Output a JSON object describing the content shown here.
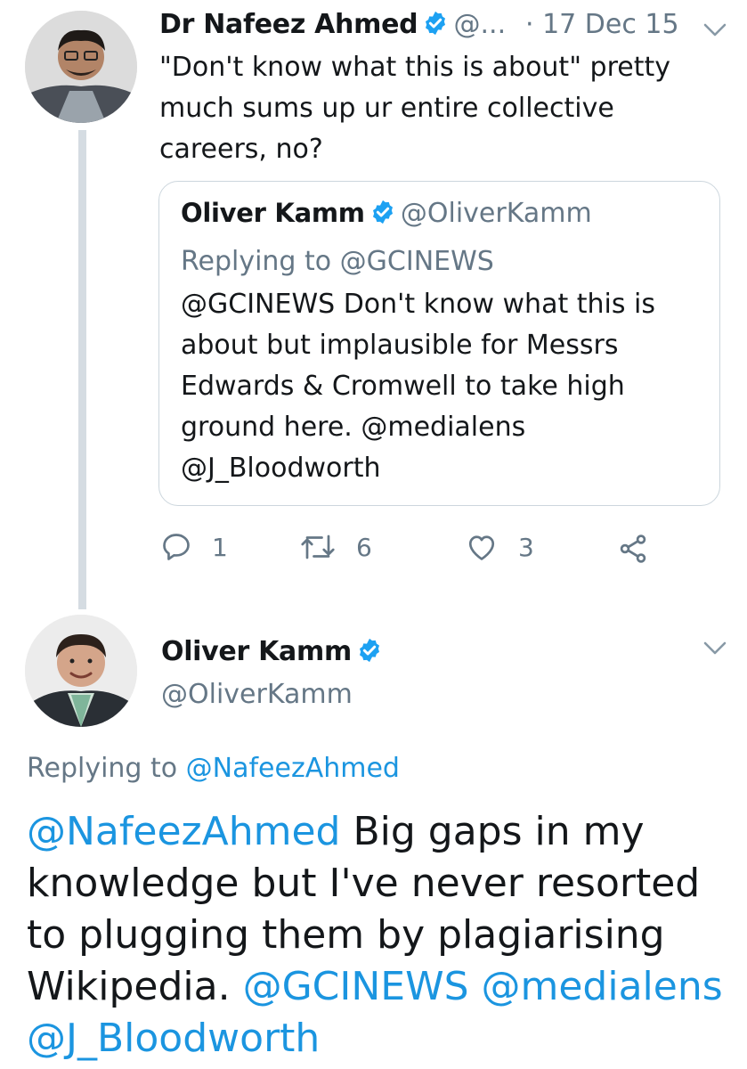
{
  "tweet1": {
    "name": "Dr Nafeez Ahmed",
    "handle": "@...",
    "date": "· 17 Dec 15",
    "text": "\"Don't know what this is about\" pretty much sums up ur entire collective careers, no?",
    "quote": {
      "name": "Oliver Kamm",
      "handle": "@OliverKamm",
      "reply_prefix": "Replying to ",
      "reply_handle": "@GCINEWS",
      "text_mention": "@GCINEWS",
      "text": " Don't know what this is about but implausible for Messrs Edwards & Cromwell to take high ground here. @medialens @J_Bloodworth"
    },
    "actions": {
      "replies": "1",
      "retweets": "6",
      "likes": "3"
    }
  },
  "tweet2": {
    "name": "Oliver Kamm",
    "handle": "@OliverKamm",
    "reply_prefix": "Replying to ",
    "reply_handle": "@NafeezAhmed",
    "mention": "@NafeezAhmed",
    "text": " Big gaps in my knowledge but I've never resorted to plugging them by plagiarising Wikipedia. ",
    "trailing_mentions": "@GCINEWS @medialens @J_Bloodworth"
  },
  "icons": {
    "verified": "verified-badge-icon",
    "caret": "chevron-down-icon",
    "reply": "reply-icon",
    "retweet": "retweet-icon",
    "like": "heart-icon",
    "share": "share-icon"
  },
  "colors": {
    "link": "#1b95e0",
    "secondary_text": "#657786",
    "thread_line": "#d5dce2",
    "border": "#ccd6dd",
    "verified": "#1da1f2"
  }
}
